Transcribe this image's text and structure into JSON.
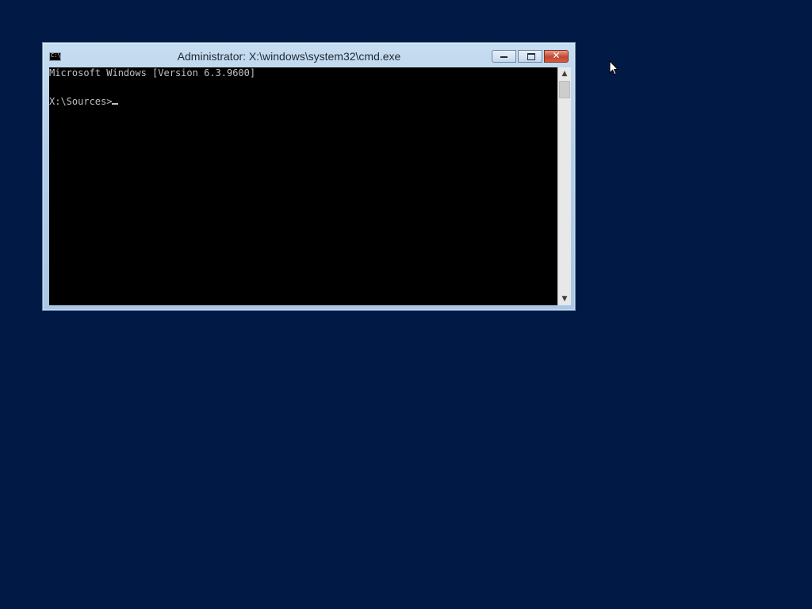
{
  "desktop": {
    "background_color": "#001a45"
  },
  "window": {
    "title": "Administrator: X:\\windows\\system32\\cmd.exe",
    "icon": "cmd-icon",
    "icon_glyph": "C:\\_",
    "buttons": {
      "minimize": "minimize-icon",
      "maximize": "maximize-icon",
      "close": "close-icon",
      "close_glyph": "✕"
    }
  },
  "console": {
    "lines": [
      "Microsoft Windows [Version 6.3.9600]",
      "X:\\Sources>"
    ]
  },
  "scrollbar": {
    "up_arrow": "▲",
    "down_arrow": "▼"
  }
}
